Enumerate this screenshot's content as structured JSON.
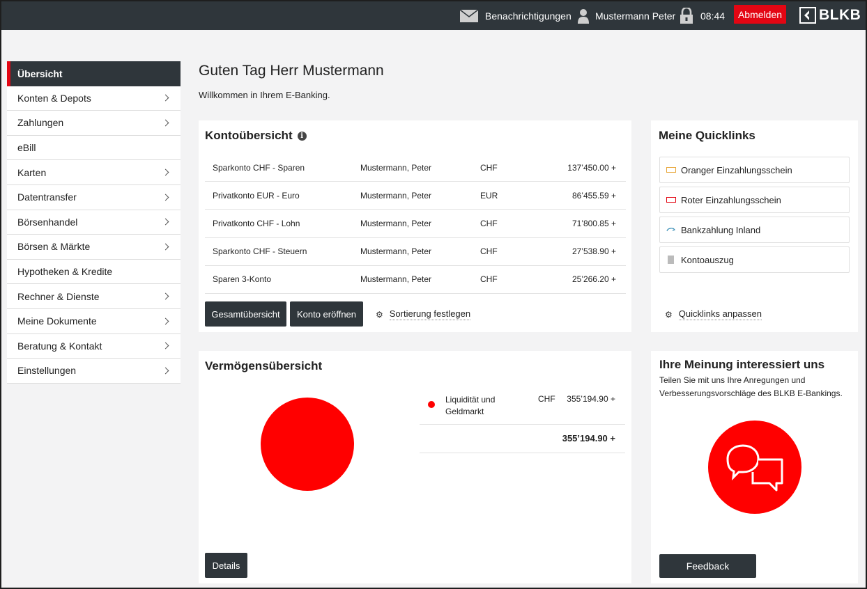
{
  "header": {
    "notifications_label": "Benachrichtigungen",
    "user_name": "Mustermann Peter",
    "session_time": "08:44",
    "logout_label": "Abmelden",
    "logo_text": "BLKB"
  },
  "sidebar": {
    "items": [
      {
        "label": "Übersicht",
        "active": true,
        "chevron": false
      },
      {
        "label": "Konten & Depots",
        "chevron": true
      },
      {
        "label": "Zahlungen",
        "chevron": true
      },
      {
        "label": "eBill",
        "chevron": false
      },
      {
        "label": "Karten",
        "chevron": true
      },
      {
        "label": "Datentransfer",
        "chevron": true
      },
      {
        "label": "Börsenhandel",
        "chevron": true
      },
      {
        "label": "Börsen & Märkte",
        "chevron": true
      },
      {
        "label": "Hypotheken & Kredite",
        "chevron": false
      },
      {
        "label": "Rechner & Dienste",
        "chevron": true
      },
      {
        "label": "Meine Dokumente",
        "chevron": true
      },
      {
        "label": "Beratung & Kontakt",
        "chevron": true
      },
      {
        "label": "Einstellungen",
        "chevron": true
      }
    ]
  },
  "greeting": {
    "title": "Guten Tag Herr Mustermann",
    "subtitle": "Willkommen in Ihrem E-Banking."
  },
  "accounts": {
    "title": "Kontoübersicht",
    "rows": [
      {
        "name": "Sparkonto CHF - Sparen",
        "holder": "Mustermann, Peter",
        "currency": "CHF",
        "balance": "137’450.00 +"
      },
      {
        "name": "Privatkonto EUR - Euro",
        "holder": "Mustermann, Peter",
        "currency": "EUR",
        "balance": "86’455.59 +"
      },
      {
        "name": "Privatkonto CHF - Lohn",
        "holder": "Mustermann, Peter",
        "currency": "CHF",
        "balance": "71’800.85 +"
      },
      {
        "name": "Sparkonto CHF - Steuern",
        "holder": "Mustermann, Peter",
        "currency": "CHF",
        "balance": "27’538.90 +"
      },
      {
        "name": "Sparen 3-Konto",
        "holder": "Mustermann, Peter",
        "currency": "CHF",
        "balance": "25’266.20 +"
      }
    ],
    "overview_button": "Gesamtübersicht",
    "open_account_button": "Konto eröffnen",
    "sort_link": "Sortierung festlegen"
  },
  "quicklinks": {
    "title": "Meine Quicklinks",
    "items": [
      {
        "label": "Oranger Einzahlungsschein",
        "icon": "orange-slip-icon"
      },
      {
        "label": "Roter Einzahlungsschein",
        "icon": "red-slip-icon"
      },
      {
        "label": "Bankzahlung Inland",
        "icon": "transfer-icon"
      },
      {
        "label": "Kontoauszug",
        "icon": "document-icon"
      }
    ],
    "adjust_link": "Quicklinks anpassen"
  },
  "assets": {
    "title": "Vermögensübersicht",
    "row_label": "Liquidität und Geldmarkt",
    "row_currency": "CHF",
    "row_value": "355’194.90 +",
    "total": "355’194.90 +",
    "details_button": "Details",
    "pie_color": "#ff0000"
  },
  "feedback": {
    "title": "Ihre Meinung interessiert uns",
    "text": "Teilen Sie mit uns Ihre Anregungen und Verbesserungsvorschläge des BLKB E-Bankings.",
    "button": "Feedback"
  },
  "colors": {
    "brand_red": "#e30613",
    "dark": "#2f363b"
  }
}
